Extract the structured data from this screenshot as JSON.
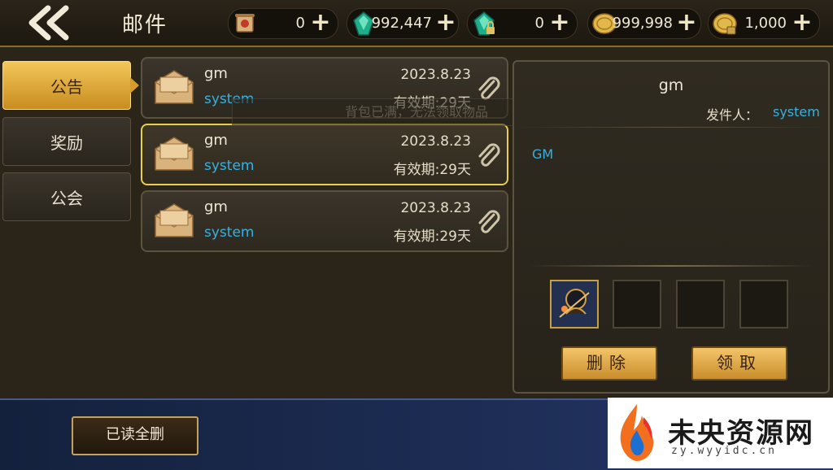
{
  "header": {
    "title": "邮件",
    "currencies": [
      {
        "icon": "scroll-icon",
        "value": "0"
      },
      {
        "icon": "gem-icon",
        "value": "992,447"
      },
      {
        "icon": "locked-gem-icon",
        "value": "0"
      },
      {
        "icon": "gold-coin-icon",
        "value": "999,998"
      },
      {
        "icon": "locked-coin-icon",
        "value": "1,000"
      }
    ]
  },
  "tabs": [
    {
      "label": "公告",
      "active": true
    },
    {
      "label": "奖励",
      "active": false
    },
    {
      "label": "公会",
      "active": false
    }
  ],
  "mails": [
    {
      "sender": "gm",
      "from": "system",
      "date": "2023.8.23",
      "expiry": "有效期:29天",
      "selected": false
    },
    {
      "sender": "gm",
      "from": "system",
      "date": "2023.8.23",
      "expiry": "有效期:29天",
      "selected": true
    },
    {
      "sender": "gm",
      "from": "system",
      "date": "2023.8.23",
      "expiry": "有效期:29天",
      "selected": false
    }
  ],
  "toast": "背包已满，无法领取物品",
  "detail": {
    "sender": "gm",
    "sender_label": "发件人：",
    "from": "system",
    "body": "GM",
    "delete_label": "删除",
    "claim_label": "领取"
  },
  "footer": {
    "read_delete_label": "已读全删"
  },
  "watermark": {
    "title": "未央资源网",
    "url": "zy.wyyidc.cn"
  },
  "colors": {
    "accent_gold": "#e6cf4c",
    "link_blue": "#38b0e0"
  }
}
